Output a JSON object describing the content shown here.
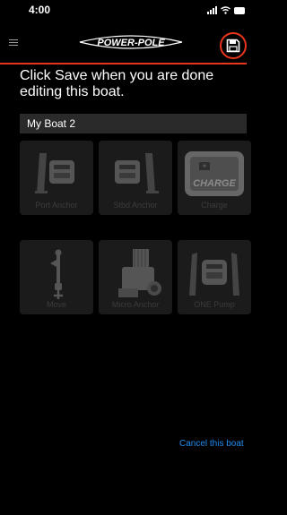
{
  "status_bar": {
    "time": "4:00"
  },
  "header": {
    "logo_text": "POWER-POLE",
    "accent_color": "#e8361e"
  },
  "instruction": "Click Save when you are done editing this boat.",
  "boat_name": {
    "value": "My Boat 2"
  },
  "tiles": [
    {
      "label": "Port Anchor",
      "icon": "port-anchor-icon"
    },
    {
      "label": "Stbd Anchor",
      "icon": "stbd-anchor-icon"
    },
    {
      "label": "Charge",
      "icon": "charge-icon",
      "badge_text": "CHARGE"
    },
    {
      "label": "Move",
      "icon": "move-icon"
    },
    {
      "label": "Micro Anchor",
      "icon": "micro-anchor-icon"
    },
    {
      "label": "ONE Pump",
      "icon": "one-pump-icon"
    }
  ],
  "cancel_link": "Cancel this boat",
  "colors": {
    "link": "#1e8df0",
    "tile_bg": "#1b1b1b",
    "dimmed": "#3c3c3c"
  }
}
